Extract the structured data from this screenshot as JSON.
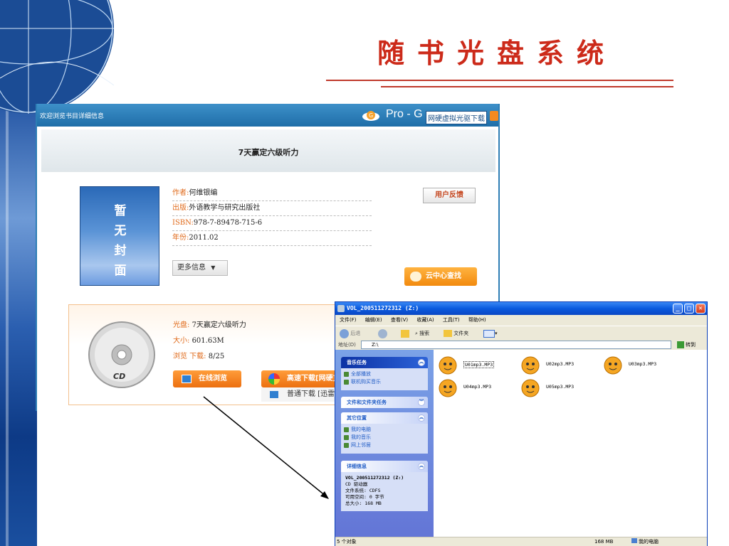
{
  "slide": {
    "title": "随书光盘系统"
  },
  "web": {
    "header": {
      "welcome": "欢迎浏览书目详细信息",
      "brand": "Pro - G",
      "virtual_disc_download": "网硬虚拟光驱下载"
    },
    "book_title": "7天赢定六级听力",
    "cover_text": [
      "暂",
      "无",
      "封",
      "面"
    ],
    "info": [
      {
        "key": "作者:",
        "value": "何维银编"
      },
      {
        "key": "出版:",
        "value": "外语教学与研究出版社"
      },
      {
        "key": "ISBN:",
        "value": "978-7-89478-715-6"
      },
      {
        "key": "年份:",
        "value": "2011.02"
      }
    ],
    "more_info": "更多信息",
    "feedback": "用户反馈",
    "cloud_search": "云中心查找",
    "disc": {
      "disc_label": "CD",
      "rows": [
        {
          "key": "光盘:",
          "value": "7天赢定六级听力"
        },
        {
          "key": "大小:",
          "value": "601.63M"
        },
        {
          "key": "浏览 下载:",
          "value": "8/25"
        }
      ],
      "online_browse": "在线浏览",
      "fast_download": "高速下载[网硬]",
      "normal_download": "普通下载 [迅雷]"
    }
  },
  "explorer": {
    "title": "VOL_200511272312 (Z:)",
    "menu": [
      "文件(F)",
      "编辑(E)",
      "查看(V)",
      "收藏(A)",
      "工具(T)",
      "帮助(H)"
    ],
    "toolbar": {
      "back": "后退",
      "search": "搜索",
      "folders": "文件夹"
    },
    "address_label": "地址(D)",
    "address": "Z:\\",
    "go": "转到",
    "music_tasks": {
      "title": "音乐任务",
      "items": [
        "全部播放",
        "联机购买音乐"
      ]
    },
    "file_tasks": {
      "title": "文件和文件夹任务"
    },
    "other_places": {
      "title": "其它位置",
      "items": [
        "我的电脑",
        "我的音乐",
        "网上邻居"
      ]
    },
    "details": {
      "title": "详细信息",
      "name": "VOL_200511272312 (Z:)",
      "lines": [
        "CD 驱动器",
        "文件系统: CDFS",
        "可用空间: 0 字节",
        "总大小: 168 MB"
      ]
    },
    "files": [
      "U01mp3.MP3",
      "U02mp3.MP3",
      "U03mp3.MP3",
      "U04mp3.MP3",
      "U05mp3.MP3"
    ],
    "status": {
      "objects": "5 个对象",
      "size": "168 MB",
      "location": "我的电脑"
    }
  },
  "colors": {
    "title_red": "#cc2a1a",
    "header_blue": "#2d7eb5",
    "orange": "#f28a0e",
    "xp_blue": "#0a5ade"
  }
}
